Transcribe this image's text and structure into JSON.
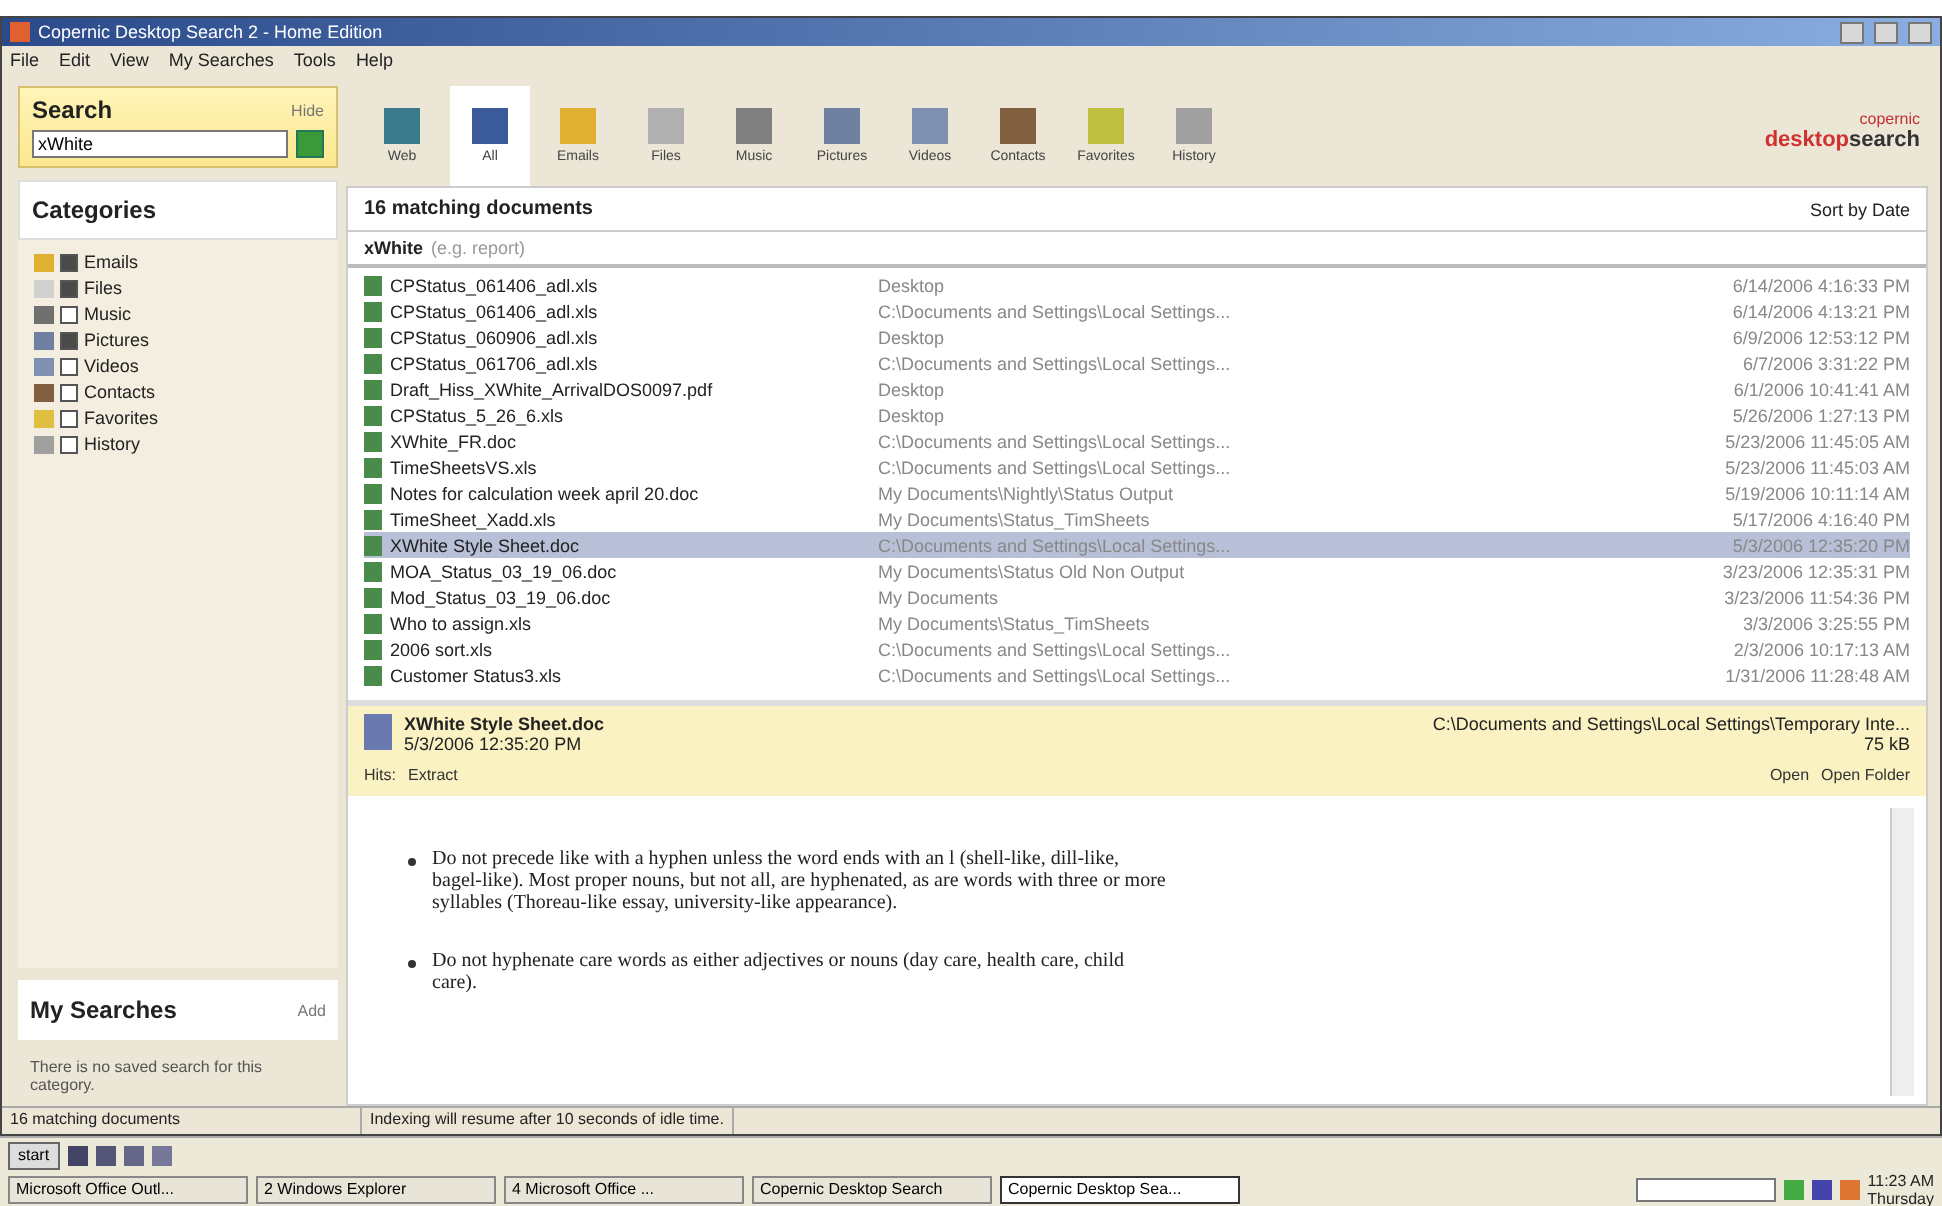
{
  "window": {
    "title": "Copernic Desktop Search 2 - Home Edition"
  },
  "menu": [
    "File",
    "Edit",
    "View",
    "My Searches",
    "Tools",
    "Help"
  ],
  "search": {
    "title": "Search",
    "hide": "Hide",
    "value": "xWhite"
  },
  "categories": {
    "title": "Categories",
    "items": [
      {
        "label": "Emails",
        "checked": true,
        "color": "#e0b030"
      },
      {
        "label": "Files",
        "checked": true,
        "color": "#d0d0d0"
      },
      {
        "label": "Music",
        "checked": false,
        "color": "#707070"
      },
      {
        "label": "Pictures",
        "checked": true,
        "color": "#7080a0"
      },
      {
        "label": "Videos",
        "checked": false,
        "color": "#8090b0"
      },
      {
        "label": "Contacts",
        "checked": false,
        "color": "#806040"
      },
      {
        "label": "Favorites",
        "checked": false,
        "color": "#e0c040"
      },
      {
        "label": "History",
        "checked": false,
        "color": "#a0a0a0"
      }
    ]
  },
  "my_searches": {
    "title": "My Searches",
    "add": "Add",
    "note": "There is no saved search for this category."
  },
  "toolbar": [
    {
      "label": "Web",
      "selected": false,
      "color": "#3a7a8a"
    },
    {
      "label": "All",
      "selected": true,
      "color": "#3a5a9a"
    },
    {
      "label": "Emails",
      "selected": false,
      "color": "#e0b030"
    },
    {
      "label": "Files",
      "selected": false,
      "color": "#b0b0b0"
    },
    {
      "label": "Music",
      "selected": false,
      "color": "#808080"
    },
    {
      "label": "Pictures",
      "selected": false,
      "color": "#7080a0"
    },
    {
      "label": "Videos",
      "selected": false,
      "color": "#8090b0"
    },
    {
      "label": "Contacts",
      "selected": false,
      "color": "#806040"
    },
    {
      "label": "Favorites",
      "selected": false,
      "color": "#c0c040"
    },
    {
      "label": "History",
      "selected": false,
      "color": "#a0a0a0"
    }
  ],
  "logo": {
    "line1": "copernic",
    "line2a": "desktop",
    "line2b": "search"
  },
  "results": {
    "heading": "16 matching documents",
    "sort": "Sort by Date",
    "filter_label": "xWhite",
    "filter_hint": "(e.g. report)",
    "rows": [
      {
        "name": "CPStatus_061406_adl.xls",
        "folder": "Desktop",
        "date": "6/14/2006 4:16:33 PM",
        "selected": false
      },
      {
        "name": "CPStatus_061406_adl.xls",
        "folder": "C:\\Documents and Settings\\Local Settings...",
        "date": "6/14/2006 4:13:21 PM",
        "selected": false
      },
      {
        "name": "CPStatus_060906_adl.xls",
        "folder": "Desktop",
        "date": "6/9/2006 12:53:12 PM",
        "selected": false
      },
      {
        "name": "CPStatus_061706_adl.xls",
        "folder": "C:\\Documents and Settings\\Local Settings...",
        "date": "6/7/2006 3:31:22 PM",
        "selected": false
      },
      {
        "name": "Draft_Hiss_XWhite_ArrivalDOS0097.pdf",
        "folder": "Desktop",
        "date": "6/1/2006 10:41:41 AM",
        "selected": false
      },
      {
        "name": "CPStatus_5_26_6.xls",
        "folder": "Desktop",
        "date": "5/26/2006 1:27:13 PM",
        "selected": false
      },
      {
        "name": "XWhite_FR.doc",
        "folder": "C:\\Documents and Settings\\Local Settings...",
        "date": "5/23/2006 11:45:05 AM",
        "selected": false
      },
      {
        "name": "TimeSheetsVS.xls",
        "folder": "C:\\Documents and Settings\\Local Settings...",
        "date": "5/23/2006 11:45:03 AM",
        "selected": false
      },
      {
        "name": "Notes for calculation week april 20.doc",
        "folder": "My Documents\\Nightly\\Status Output",
        "date": "5/19/2006 10:11:14 AM",
        "selected": false
      },
      {
        "name": "TimeSheet_Xadd.xls",
        "folder": "My Documents\\Status_TimSheets",
        "date": "5/17/2006 4:16:40 PM",
        "selected": false
      },
      {
        "name": "XWhite Style Sheet.doc",
        "folder": "C:\\Documents and Settings\\Local Settings...",
        "date": "5/3/2006 12:35:20 PM",
        "selected": true
      },
      {
        "name": "MOA_Status_03_19_06.doc",
        "folder": "My Documents\\Status Old Non Output",
        "date": "3/23/2006 12:35:31 PM",
        "selected": false
      },
      {
        "name": "Mod_Status_03_19_06.doc",
        "folder": "My Documents",
        "date": "3/23/2006 11:54:36 PM",
        "selected": false
      },
      {
        "name": "Who to assign.xls",
        "folder": "My Documents\\Status_TimSheets",
        "date": "3/3/2006 3:25:55 PM",
        "selected": false
      },
      {
        "name": "2006 sort.xls",
        "folder": "C:\\Documents and Settings\\Local Settings...",
        "date": "2/3/2006 10:17:13 AM",
        "selected": false
      },
      {
        "name": "Customer Status3.xls",
        "folder": "C:\\Documents and Settings\\Local Settings...",
        "date": "1/31/2006 11:28:48 AM",
        "selected": false
      }
    ]
  },
  "preview": {
    "name": "XWhite Style Sheet.doc",
    "date": "5/3/2006 12:35:20 PM",
    "path": "C:\\Documents and Settings\\Local Settings\\Temporary Inte...",
    "size": "75 kB",
    "hits_label": "Hits:",
    "hits_item": "Extract",
    "open": "Open",
    "open_folder": "Open Folder",
    "bullets": [
      "Do not precede like with a hyphen unless the word ends with an l (shell-like, dill-like, bagel-like). Most proper nouns, but not all, are hyphenated, as are words with three or more syllables (Thoreau-like essay, university-like appearance).",
      "Do not hyphenate care words as either adjectives or nouns (day care, health care, child care)."
    ]
  },
  "status_bar": [
    "16 matching documents",
    "Indexing will resume after 10 seconds of idle time."
  ],
  "taskbar": {
    "start": "start",
    "tasks": [
      {
        "label": "Microsoft Office Outl...",
        "selected": false
      },
      {
        "label": "2 Windows Explorer",
        "selected": false
      },
      {
        "label": "4 Microsoft Office ...",
        "selected": false
      },
      {
        "label": "Copernic Desktop Search",
        "selected": false
      },
      {
        "label": "Copernic Desktop Sea...",
        "selected": true
      }
    ],
    "clock": "11:23 AM",
    "day": "Thursday"
  }
}
